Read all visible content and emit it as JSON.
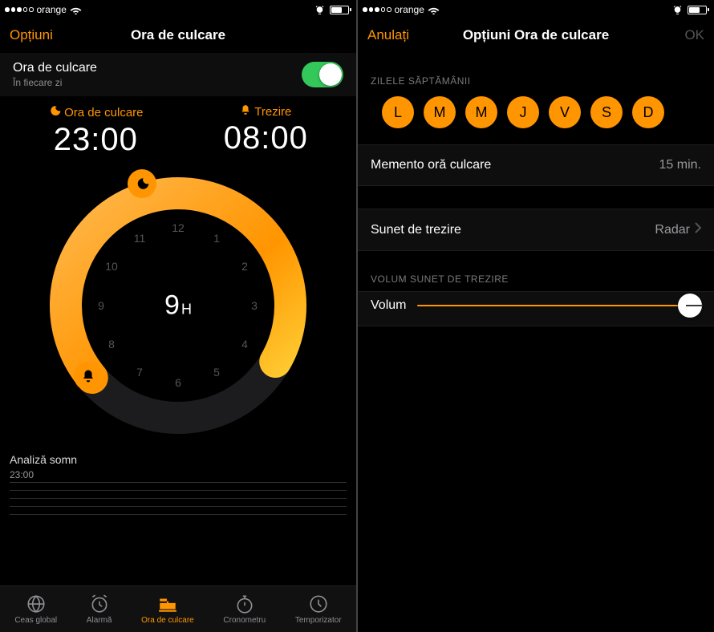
{
  "status": {
    "carrier": "orange",
    "signal_filled": 3,
    "signal_total": 5,
    "battery_pct": 60
  },
  "left": {
    "nav": {
      "left": "Opțiuni",
      "title": "Ora de culcare"
    },
    "bedtime_toggle": {
      "title": "Ora de culcare",
      "subtitle": "În fiecare zi",
      "on": true
    },
    "bedtime": {
      "label": "Ora de culcare",
      "time": "23:00"
    },
    "wake": {
      "label": "Trezire",
      "time": "08:00"
    },
    "duration": {
      "value": "9",
      "unit": "H"
    },
    "analysis": {
      "title": "Analiză somn",
      "time": "23:00"
    },
    "tabs": [
      {
        "label": "Ceas global"
      },
      {
        "label": "Alarmă"
      },
      {
        "label": "Ora de culcare"
      },
      {
        "label": "Cronometru"
      },
      {
        "label": "Temporizator"
      }
    ],
    "active_tab": 2
  },
  "right": {
    "nav": {
      "left": "Anulați",
      "title": "Opțiuni Ora de culcare",
      "right": "OK"
    },
    "days_header": "ZILELE SĂPTĂMÂNII",
    "days": [
      "L",
      "M",
      "M",
      "J",
      "V",
      "S",
      "D"
    ],
    "reminder": {
      "label": "Memento oră culcare",
      "value": "15 min."
    },
    "sound": {
      "label": "Sunet de trezire",
      "value": "Radar"
    },
    "volume_header": "VOLUM SUNET DE TREZIRE",
    "volume_label": "Volum",
    "volume_pct": 94
  },
  "colors": {
    "accent": "#ff9500",
    "green": "#34c759"
  }
}
